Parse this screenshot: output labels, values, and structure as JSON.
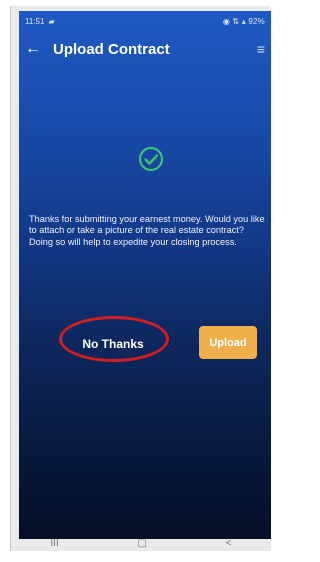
{
  "status": {
    "time": "11:51",
    "notification_icon": "message-icon",
    "right": "◉ ⇅ ▴ 92%"
  },
  "header": {
    "title": "Upload Contract",
    "back_icon": "back-arrow-icon",
    "menu_icon": "menu-icon"
  },
  "message": {
    "text": "Thanks for submitting your earnest money. Would you like to attach or take a picture of the real estate contract? Doing so will help to expedite your closing process."
  },
  "buttons": {
    "no_thanks": "No Thanks",
    "upload": "Upload"
  },
  "nav": {
    "recent": "III",
    "home": "▢",
    "back": "<"
  },
  "colors": {
    "accent": "#efaf4a",
    "success": "#39c46f",
    "highlight": "#d31d23"
  }
}
